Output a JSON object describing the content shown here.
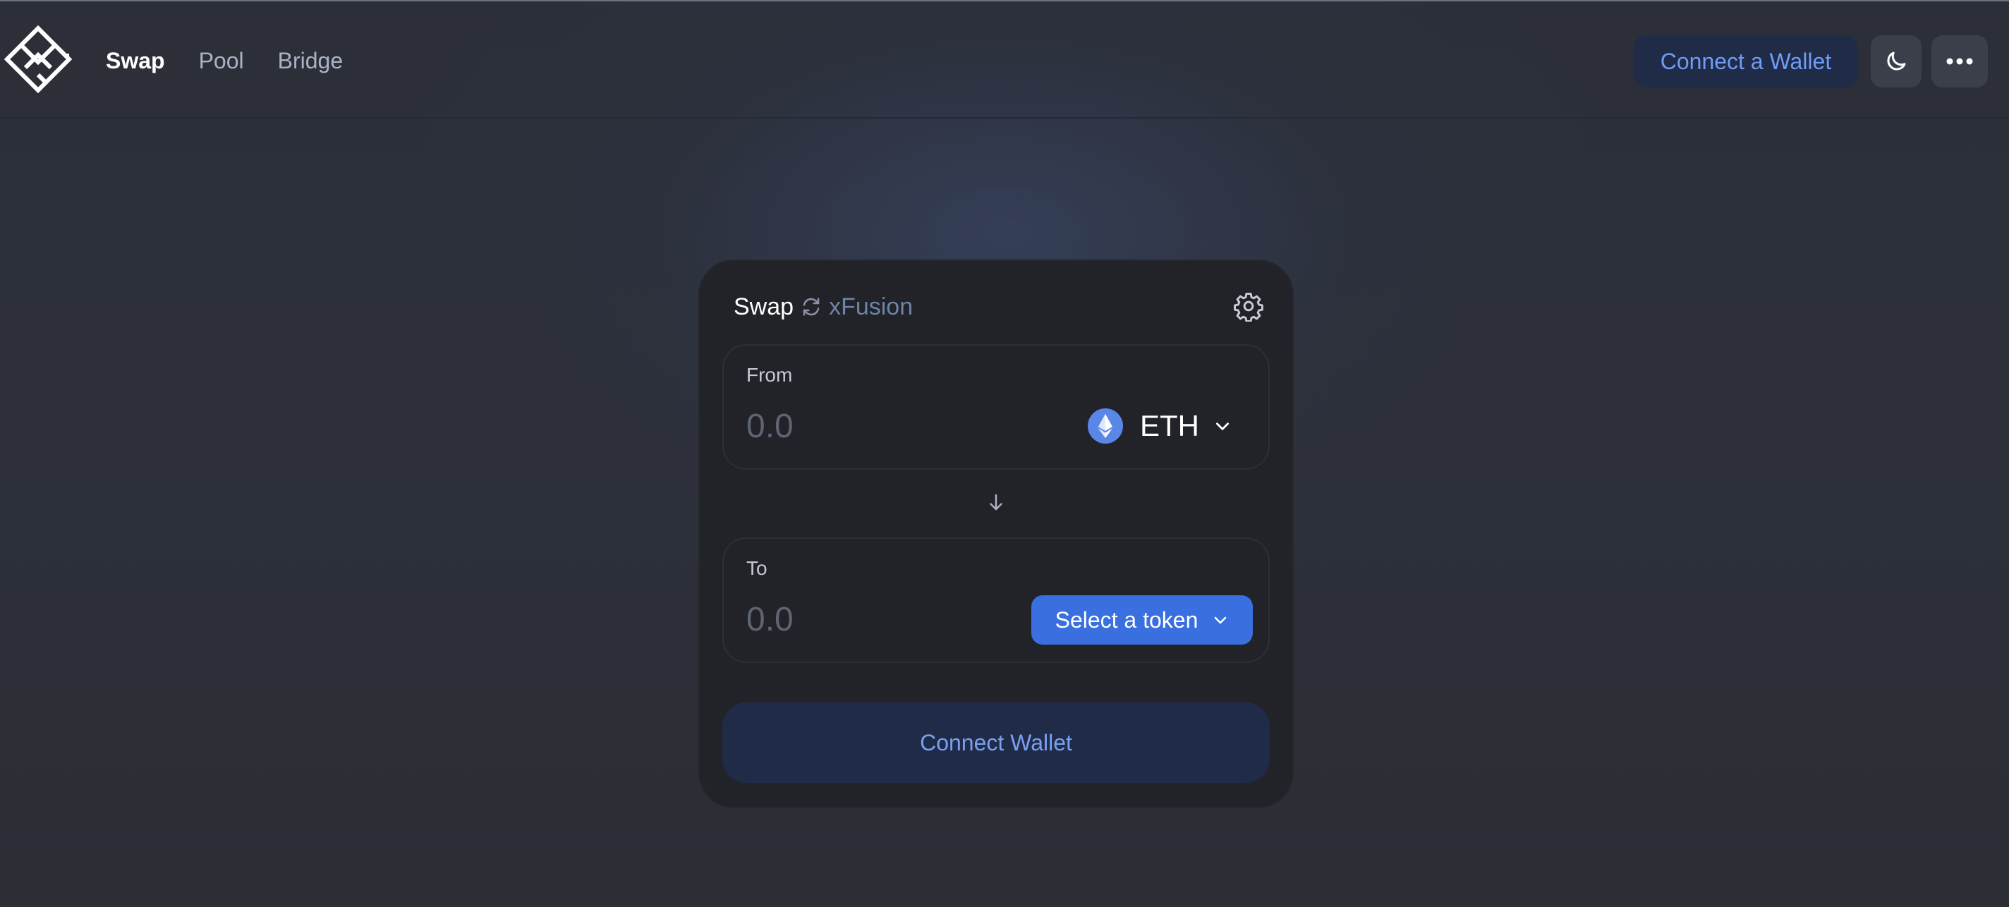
{
  "nav": {
    "items": [
      {
        "label": "Swap",
        "active": true
      },
      {
        "label": "Pool",
        "active": false
      },
      {
        "label": "Bridge",
        "active": false
      }
    ]
  },
  "header": {
    "connect_label": "Connect a Wallet",
    "theme_icon": "moon-icon",
    "more_icon": "ellipsis-icon"
  },
  "swap_card": {
    "title": "Swap",
    "brand": "xFusion",
    "from": {
      "label": "From",
      "amount_placeholder": "0.0",
      "token": "ETH"
    },
    "to": {
      "label": "To",
      "amount_placeholder": "0.0",
      "select_label": "Select a token"
    },
    "connect_label": "Connect Wallet"
  },
  "colors": {
    "accent": "#3a6fe0",
    "wallet_button_bg": "#1f2b47",
    "wallet_button_text": "#6f9cf5",
    "card_bg": "#212329",
    "page_bg": "#2c2f38"
  }
}
